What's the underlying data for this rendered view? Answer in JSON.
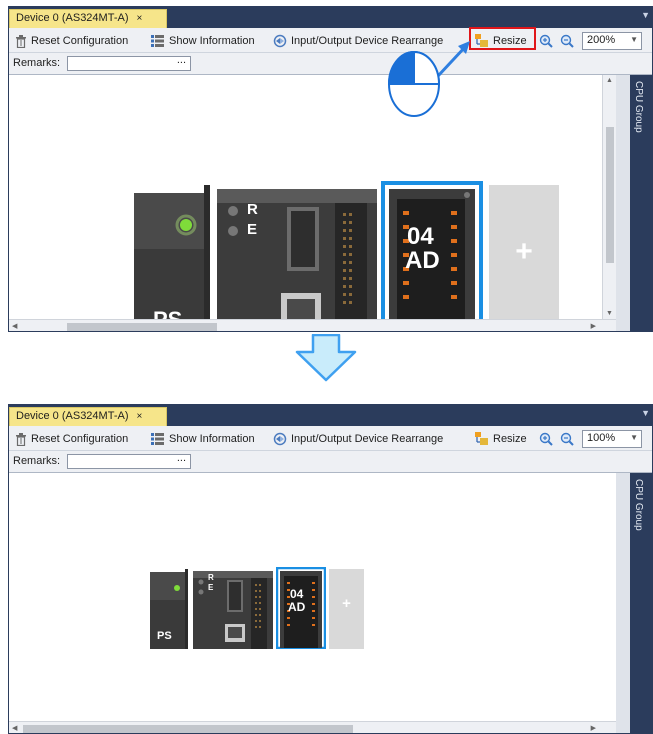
{
  "top": {
    "tab_label": "Device 0 (AS324MT-A)",
    "tab_close": "×",
    "toolbar": {
      "reset": "Reset Configuration",
      "show_info": "Show Information",
      "io_rearrange": "Input/Output Device Rearrange",
      "resize": "Resize",
      "zoom_value": "200%"
    },
    "remarks_label": "Remarks:",
    "remarks_value": "",
    "remarks_button": "...",
    "side_panel": "CPU Group",
    "modules": {
      "ps_label": "PS",
      "cpu_r": "R",
      "cpu_e": "E",
      "ad_top": "04",
      "ad_bottom": "AD",
      "add": "+"
    }
  },
  "bottom": {
    "tab_label": "Device 0 (AS324MT-A)",
    "tab_close": "×",
    "toolbar": {
      "reset": "Reset Configuration",
      "show_info": "Show Information",
      "io_rearrange": "Input/Output Device Rearrange",
      "resize": "Resize",
      "zoom_value": "100%"
    },
    "remarks_label": "Remarks:",
    "remarks_value": "",
    "remarks_button": "...",
    "side_panel": "CPU Group",
    "modules": {
      "ps_label": "PS",
      "cpu_r": "R",
      "cpu_e": "E",
      "ad_top": "04",
      "ad_bottom": "AD",
      "add": "+"
    }
  },
  "colors": {
    "tab_active": "#f6e58a",
    "chrome_dark": "#2b3c5c",
    "selection_blue": "#1a8fe3",
    "highlight_red": "#e0161a",
    "transition_arrow": "#3fa0f0"
  },
  "icons": [
    "trash-icon",
    "list-icon",
    "rearrange-icon",
    "resize-icon",
    "zoom-in-icon",
    "zoom-out-icon",
    "mouse-icon",
    "arrow-down-icon"
  ]
}
